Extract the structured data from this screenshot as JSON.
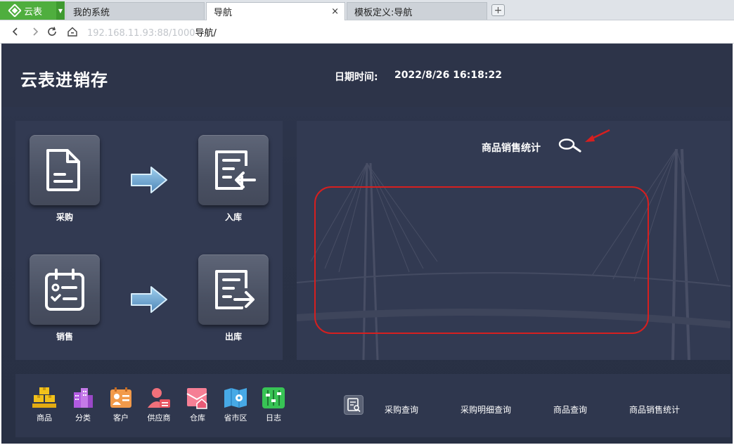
{
  "browser": {
    "brand_label": "云表",
    "tabs": [
      {
        "label": "我的系统"
      },
      {
        "label": "导航",
        "close": "×"
      },
      {
        "label": "模板定义:导航"
      }
    ],
    "new_tab": "+",
    "url_faded": "192.168.11.93:88/1000",
    "url_main": "导航/"
  },
  "header": {
    "title": "云表进销存",
    "datetime_label": "日期时间:",
    "datetime_value": "2022/8/26 16:18:22"
  },
  "flow": {
    "items": [
      {
        "label": "采购",
        "icon": "document-icon"
      },
      {
        "label": "入库",
        "icon": "inbound-icon"
      },
      {
        "label": "销售",
        "icon": "checklist-icon"
      },
      {
        "label": "出库",
        "icon": "outbound-icon"
      }
    ]
  },
  "stats": {
    "title": "商品销售统计",
    "annotation_color": "#d61f1f"
  },
  "bottom_nav": {
    "items": [
      {
        "label": "商品",
        "icon": "goods-icon",
        "color": "#f2c21b"
      },
      {
        "label": "分类",
        "icon": "category-icon",
        "color": "#b15be0"
      },
      {
        "label": "客户",
        "icon": "customer-icon",
        "color": "#f29a4a"
      },
      {
        "label": "供应商",
        "icon": "supplier-icon",
        "color": "#f0707a"
      },
      {
        "label": "仓库",
        "icon": "warehouse-icon",
        "color": "#f57f95"
      },
      {
        "label": "省市区",
        "icon": "map-icon",
        "color": "#47a9e6"
      },
      {
        "label": "日志",
        "icon": "log-icon",
        "color": "#38c455"
      }
    ],
    "queries": [
      {
        "label": "采购查询"
      },
      {
        "label": "采购明细查询"
      },
      {
        "label": "商品查询"
      },
      {
        "label": "商品销售统计"
      }
    ]
  }
}
